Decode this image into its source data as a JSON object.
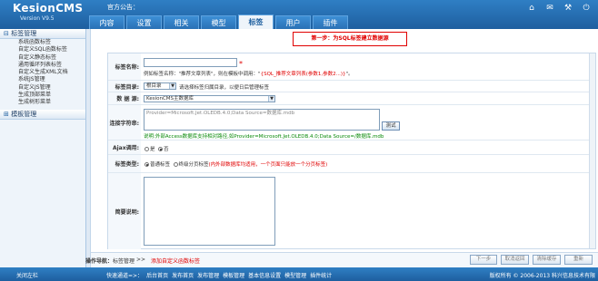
{
  "app": {
    "name": "KesionCMS",
    "version": "Version V9.5",
    "notice": "官方公告："
  },
  "tabs": [
    "内容",
    "设置",
    "相关",
    "模型",
    "标签",
    "用户",
    "插件"
  ],
  "sidebar": {
    "section1": "标签管理",
    "items": [
      "系统函数标签",
      "自定义SQL函数标签",
      "自定义静态标签",
      "通用循环列表标签",
      "自定义生成XML文档",
      "系统JS管理",
      "自定义JS管理",
      "生成顶部菜单",
      "生成树形菜单"
    ],
    "section2": "模板管理"
  },
  "step": "第一步：为SQL标签建立数据源",
  "form": {
    "name_label": "标签名称:",
    "name_value": "",
    "name_req": "*",
    "name_hint_pre": "例如标签名称：\"推荐文章列表\"，则在模板中调用：\"",
    "name_hint_red": "{SQL_推荐文章列表(参数1,参数2...)}",
    "name_hint_post": "\"。",
    "dir_label": "标签目录:",
    "dir_value": "根目录",
    "dir_hint": "请选择标签归属目录，以便日后管理标签",
    "db_label": "数 据 源:",
    "db_value": "KesionCMS主数据库",
    "conn_label": "连接字符串:",
    "conn_value": "Provider=Microsoft.Jet.OLEDB.4.0;Data Source=数据库.mdb",
    "test_button": "测试",
    "conn_hint": "说明:外部Access数据库支持相对路径,如Provider=Microsoft.Jet.OLEDB.4.0;Data Source=/数据库.mdb",
    "ajax_label": "Ajax调用:",
    "ajax_yes": "是",
    "ajax_no": "否",
    "type_label": "标签类型:",
    "type_normal": "普通标签",
    "type_page": "终级分页标签",
    "type_hint": "(内外部数据库均适用，一个页面只能放一个分页标签)",
    "desc_label": "简要说明:",
    "desc_value": ""
  },
  "nav": {
    "label": "操作导航：",
    "link1": "标签管理",
    "sep": " >> ",
    "link2": "添加自定义函数标签",
    "next": "下一步",
    "cancel": "取消返回",
    "clear": "清除缓存",
    "last": "重新"
  },
  "footer": {
    "left": "关闭左栏",
    "quick": "快速通道=>：",
    "links": [
      "后台首页",
      "发布首页",
      "发布管理",
      "模板管理",
      "基本信息设置",
      "模型管理",
      "插件统计"
    ],
    "copyright": "版权所有 © 2006-2013 科兴信息技术有限"
  },
  "colors": {
    "header": "#2a73b8",
    "accent_red": "#e00000",
    "hint_green": "#0a8a0a"
  },
  "icons": [
    "home-icon",
    "envelope-icon",
    "wrench-icon",
    "power-icon"
  ]
}
